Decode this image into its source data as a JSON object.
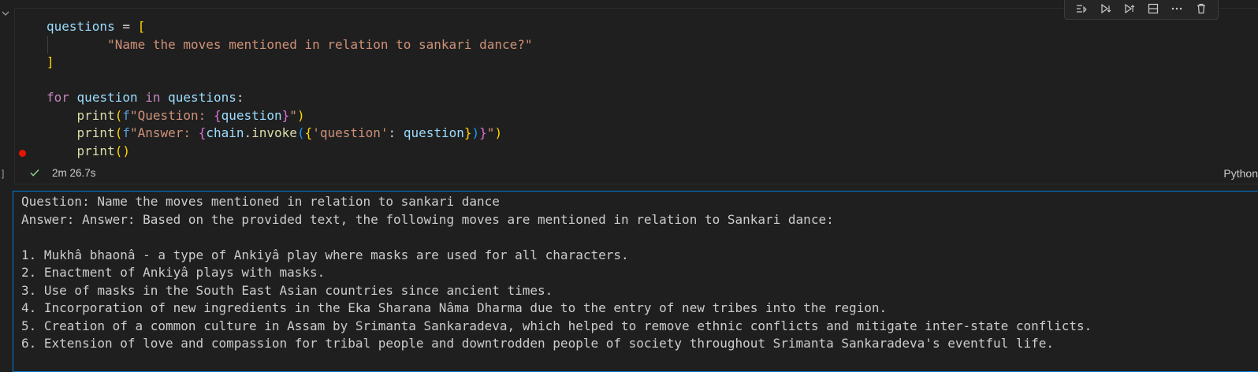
{
  "cell": {
    "code_lines": [
      [
        {
          "t": "questions",
          "c": "var"
        },
        {
          "t": " = ",
          "c": "op"
        },
        {
          "t": "[",
          "c": "br1"
        }
      ],
      [
        {
          "t": "        ",
          "c": "op"
        },
        {
          "t": "\"Name the moves mentioned in relation to sankari dance?\"",
          "c": "str"
        }
      ],
      [
        {
          "t": "]",
          "c": "br1"
        }
      ],
      [],
      [
        {
          "t": "for",
          "c": "kw"
        },
        {
          "t": " ",
          "c": "op"
        },
        {
          "t": "question",
          "c": "var"
        },
        {
          "t": " ",
          "c": "op"
        },
        {
          "t": "in",
          "c": "kw"
        },
        {
          "t": " ",
          "c": "op"
        },
        {
          "t": "questions",
          "c": "var"
        },
        {
          "t": ":",
          "c": "op"
        }
      ],
      [
        {
          "t": "    ",
          "c": "op"
        },
        {
          "t": "print",
          "c": "fn"
        },
        {
          "t": "(",
          "c": "br1"
        },
        {
          "t": "f",
          "c": "fpre"
        },
        {
          "t": "\"Question: ",
          "c": "str"
        },
        {
          "t": "{",
          "c": "br2"
        },
        {
          "t": "question",
          "c": "var"
        },
        {
          "t": "}",
          "c": "br2"
        },
        {
          "t": "\"",
          "c": "str"
        },
        {
          "t": ")",
          "c": "br1"
        }
      ],
      [
        {
          "t": "    ",
          "c": "op"
        },
        {
          "t": "print",
          "c": "fn"
        },
        {
          "t": "(",
          "c": "br1"
        },
        {
          "t": "f",
          "c": "fpre"
        },
        {
          "t": "\"Answer: ",
          "c": "str"
        },
        {
          "t": "{",
          "c": "br2"
        },
        {
          "t": "chain",
          "c": "var"
        },
        {
          "t": ".",
          "c": "op"
        },
        {
          "t": "invoke",
          "c": "fn"
        },
        {
          "t": "(",
          "c": "br3"
        },
        {
          "t": "{",
          "c": "br1"
        },
        {
          "t": "'question'",
          "c": "str"
        },
        {
          "t": ": ",
          "c": "op"
        },
        {
          "t": "question",
          "c": "var"
        },
        {
          "t": "}",
          "c": "br1"
        },
        {
          "t": ")",
          "c": "br3"
        },
        {
          "t": "}",
          "c": "br2"
        },
        {
          "t": "\"",
          "c": "str"
        },
        {
          "t": ")",
          "c": "br1"
        }
      ],
      [
        {
          "t": "    ",
          "c": "op"
        },
        {
          "t": "print",
          "c": "fn"
        },
        {
          "t": "()",
          "c": "br1"
        }
      ]
    ],
    "execution_time": "2m 26.7s",
    "language": "Python",
    "status_icon": "check-icon",
    "toolbar_icons": [
      "execute-above-icon",
      "execute-below-icon",
      "run-below-icon",
      "split-cell-icon",
      "more-icon",
      "delete-icon"
    ]
  },
  "output": {
    "lines": [
      "Question: Name the moves mentioned in relation to sankari dance",
      "Answer: Answer: Based on the provided text, the following moves are mentioned in relation to Sankari dance:",
      "",
      "1. Mukhâ bhaonâ - a type of Ankiyâ play where masks are used for all characters.",
      "2. Enactment of Ankiyâ plays with masks.",
      "3. Use of masks in the South East Asian countries since ancient times.",
      "4. Incorporation of new ingredients in the Eka Sharana Nâma Dharma due to the entry of new tribes into the region.",
      "5. Creation of a common culture in Assam by Srimanta Sankaradeva, which helped to remove ethnic conflicts and mitigate inter-state conflicts.",
      "6. Extension of love and compassion for tribal people and downtrodden people of society throughout Srimanta Sankaradeva's eventful life."
    ]
  },
  "colors": {
    "background": "#1f1f1f",
    "focus_border": "#0078d4",
    "success": "#89d185",
    "breakpoint": "#e51400"
  }
}
